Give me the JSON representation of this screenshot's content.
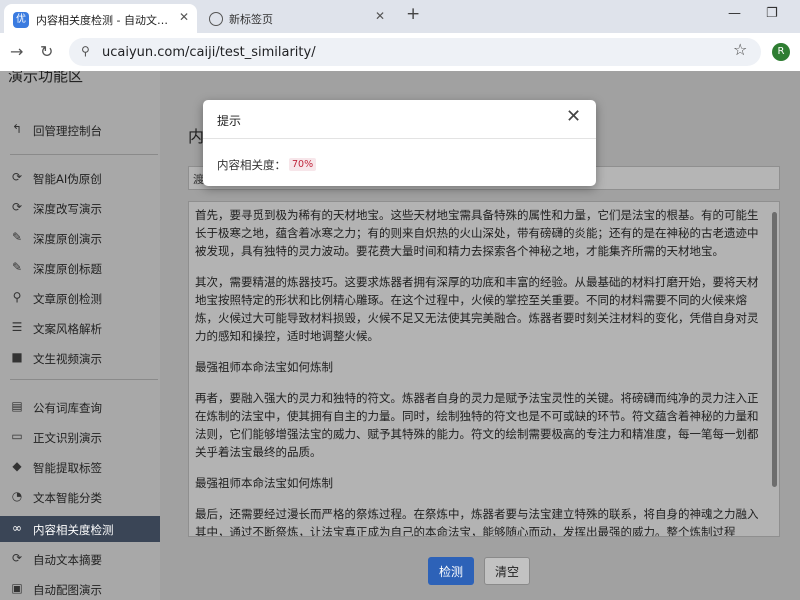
{
  "browser": {
    "tabs": [
      {
        "title": "内容相关度检测 - 自动文章采集",
        "favicon": "优",
        "active": true
      },
      {
        "title": "新标签页",
        "active": false
      }
    ],
    "new_tab": "+",
    "address": {
      "url": "ucaiyun.com/caiji/test_similarity/"
    },
    "profile": "R"
  },
  "sidebar": {
    "brand": "演示功能区",
    "back": {
      "label": "回管理控制台",
      "icon": "back-arrow-icon"
    },
    "items": [
      {
        "label": "智能AI伪原创",
        "icon": "refresh-icon"
      },
      {
        "label": "深度改写演示",
        "icon": "refresh-icon"
      },
      {
        "label": "深度原创演示",
        "icon": "edit-icon"
      },
      {
        "label": "深度原创标题",
        "icon": "edit-icon"
      },
      {
        "label": "文章原创检测",
        "icon": "search-icon"
      },
      {
        "label": "文案风格解析",
        "icon": "list-icon"
      },
      {
        "label": "文生视频演示",
        "icon": "video-icon"
      },
      {
        "label": "公有词库查询",
        "icon": "book-icon"
      },
      {
        "label": "正文识别演示",
        "icon": "monitor-icon"
      },
      {
        "label": "智能提取标签",
        "icon": "tag-icon"
      },
      {
        "label": "文本智能分类",
        "icon": "pie-icon"
      },
      {
        "label": "内容相关度检测",
        "icon": "link-icon",
        "active": true
      },
      {
        "label": "自动文本摘要",
        "icon": "refresh-icon"
      },
      {
        "label": "自动配图演示",
        "icon": "image-icon"
      }
    ]
  },
  "main": {
    "title": "内",
    "input_value": "渡",
    "paragraphs": [
      "首先，要寻觅到极为稀有的天材地宝。这些天材地宝需具备特殊的属性和力量，它们是法宝的根基。有的可能生长于极寒之地，蕴含着冰寒之力；有的则来自炽热的火山深处，带有磅礴的炎能；还有的是在神秘的古老遗迹中被发现，具有独特的灵力波动。要花费大量时间和精力去探索各个神秘之地，才能集齐所需的天材地宝。",
      "其次，需要精湛的炼器技巧。这要求炼器者拥有深厚的功底和丰富的经验。从最基础的材料打磨开始，要将天材地宝按照特定的形状和比例精心雕琢。在这个过程中，火候的掌控至关重要。不同的材料需要不同的火候来熔炼，火候过大可能导致材料损毁，火候不足又无法使其完美融合。炼器者要时刻关注材料的变化，凭借自身对灵力的感知和操控，适时地调整火候。",
      "最强祖师本命法宝如何炼制",
      "再者，要融入强大的灵力和独特的符文。炼器者自身的灵力是赋予法宝灵性的关键。将磅礴而纯净的灵力注入正在炼制的法宝中，使其拥有自主的力量。同时，绘制独特的符文也是不可或缺的环节。符文蕴含着神秘的力量和法则，它们能够增强法宝的威力、赋予其特殊的能力。符文的绘制需要极高的专注力和精准度，每一笔每一划都关乎着法宝最终的品质。",
      "最强祖师本命法宝如何炼制",
      "最后，还需要经过漫长而严格的祭炼过程。在祭炼中，炼器者要与法宝建立特殊的联系，将自身的神魂之力融入其中，通过不断祭炼，让法宝真正成为自己的本命法宝，能够随心而动，发挥出最强的威力。整个炼制过程"
    ],
    "buttons": {
      "detect": "检测",
      "clear": "清空"
    }
  },
  "modal": {
    "title": "提示",
    "label": "内容相关度：",
    "value": "70%",
    "close": "✕"
  },
  "colors": {
    "primary": "#2d62b8",
    "sidebar_active": "#3a4556",
    "badge_text": "#c0263c"
  }
}
